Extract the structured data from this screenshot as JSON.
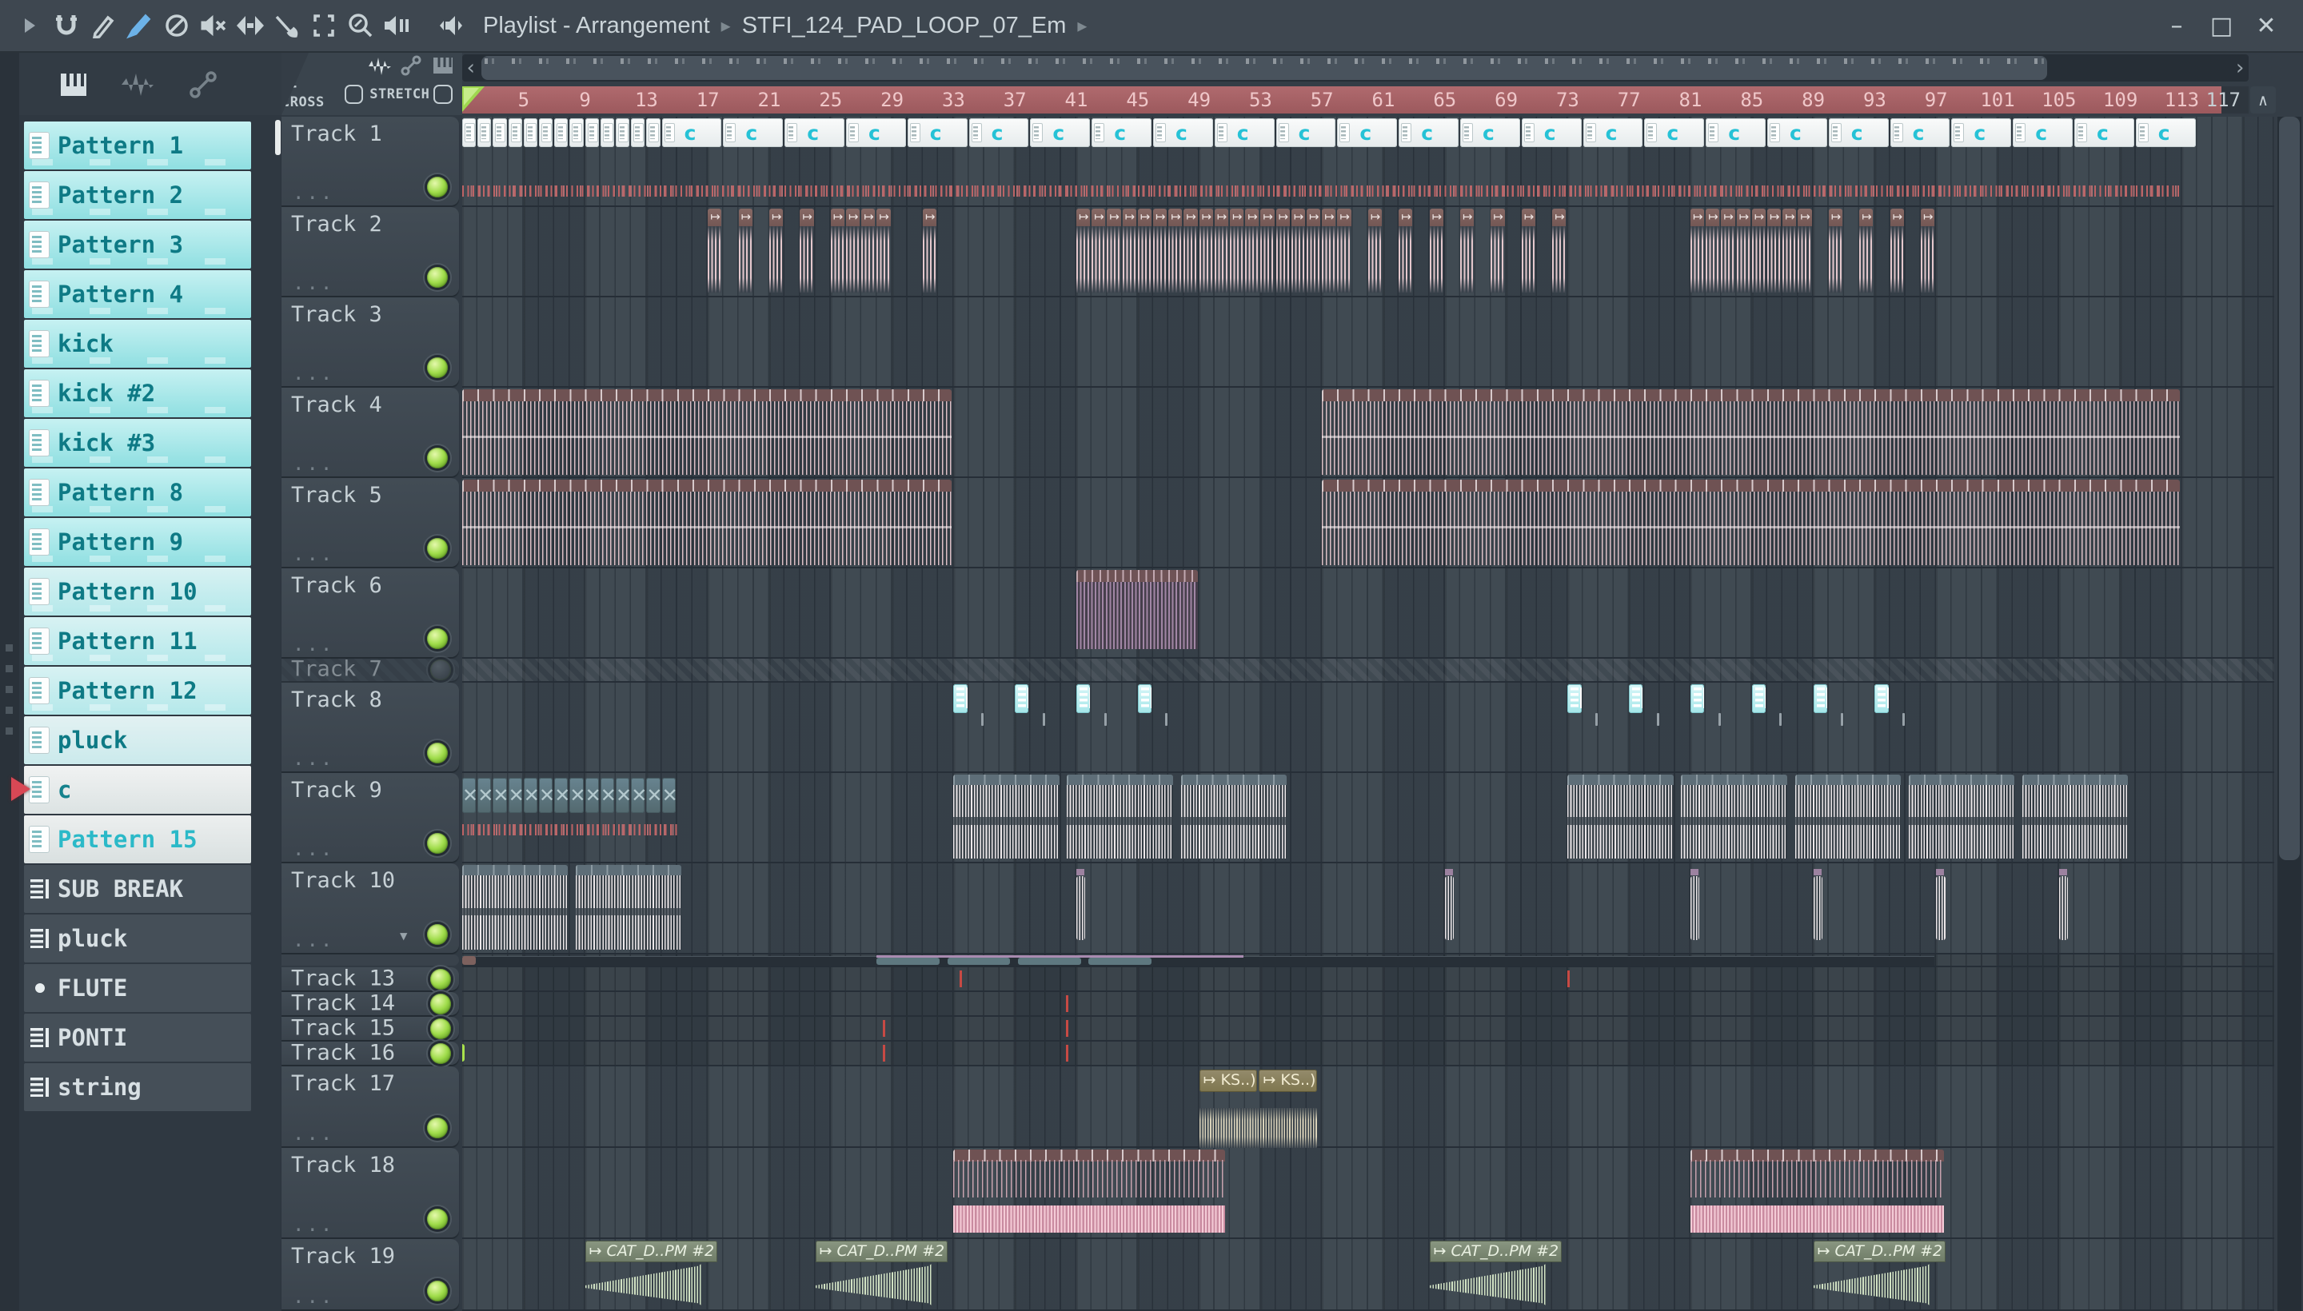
{
  "titlebar": {
    "section": "Playlist - Arrangement",
    "file": "STFI_124_PAD_LOOP_07_Em",
    "crumb_sep": "▸",
    "window": {
      "minimize": "–",
      "maximize": "□",
      "close": "✕"
    }
  },
  "toolbar": {
    "zcross": "Z-CROSS",
    "stretch": "STRETCH"
  },
  "glyphs": {
    "audio": "↦",
    "x": "✕",
    "up": "∧",
    "left": "‹",
    "right": "›",
    "dots": "...",
    "collapse": "▾",
    "bullet": "•"
  },
  "ruler": {
    "numbers": [
      5,
      9,
      13,
      17,
      21,
      25,
      29,
      33,
      37,
      41,
      45,
      49,
      53,
      57,
      61,
      65,
      69,
      73,
      77,
      81,
      85,
      89,
      93,
      97,
      101,
      105,
      109,
      113
    ],
    "end": "117"
  },
  "patterns": [
    {
      "label": "Pattern 1",
      "style": "cyan"
    },
    {
      "label": "Pattern 2",
      "style": "cyan"
    },
    {
      "label": "Pattern 3",
      "style": "cyan"
    },
    {
      "label": "Pattern 4",
      "style": "cyan"
    },
    {
      "label": "kick",
      "style": "cyan"
    },
    {
      "label": "kick #2",
      "style": "cyan"
    },
    {
      "label": "kick #3",
      "style": "cyan"
    },
    {
      "label": "Pattern 8",
      "style": "cyan"
    },
    {
      "label": "Pattern 9",
      "style": "cyan"
    },
    {
      "label": "Pattern 10",
      "style": "cyan2"
    },
    {
      "label": "Pattern 11",
      "style": "cyan2"
    },
    {
      "label": "Pattern 12",
      "style": "cyan2"
    },
    {
      "label": "pluck",
      "style": "cyan3"
    },
    {
      "label": "c",
      "style": "white",
      "selected": true
    },
    {
      "label": "Pattern 15",
      "style": "white2"
    },
    {
      "label": "SUB BREAK",
      "style": "dark"
    },
    {
      "label": "pluck",
      "style": "dark"
    },
    {
      "label": "FLUTE",
      "style": "darkdot"
    },
    {
      "label": "PONTI",
      "style": "dark"
    },
    {
      "label": "string",
      "style": "dark"
    }
  ],
  "tracks": [
    {
      "name": "Track 1",
      "h": 113,
      "kind": "tall"
    },
    {
      "name": "Track 2",
      "h": 113,
      "kind": "tall"
    },
    {
      "name": "Track 3",
      "h": 113,
      "kind": "tall"
    },
    {
      "name": "Track 4",
      "h": 113,
      "kind": "tall"
    },
    {
      "name": "Track 5",
      "h": 113,
      "kind": "tall"
    },
    {
      "name": "Track 6",
      "h": 113,
      "kind": "tall"
    },
    {
      "name": "Track 7",
      "h": 30,
      "kind": "dim"
    },
    {
      "name": "Track 8",
      "h": 113,
      "kind": "tall"
    },
    {
      "name": "Track 9",
      "h": 113,
      "kind": "tall"
    },
    {
      "name": "Track 10",
      "h": 114,
      "kind": "tall",
      "arrow": true
    },
    {
      "name": "",
      "h": 16,
      "kind": "thin"
    },
    {
      "name": "Track 13",
      "h": 31,
      "kind": "small"
    },
    {
      "name": "Track 14",
      "h": 31,
      "kind": "small"
    },
    {
      "name": "Track 15",
      "h": 31,
      "kind": "small"
    },
    {
      "name": "Track 16",
      "h": 31,
      "kind": "small"
    },
    {
      "name": "Track 17",
      "h": 102,
      "kind": "tall"
    },
    {
      "name": "Track 18",
      "h": 114,
      "kind": "tall"
    },
    {
      "name": "Track 19",
      "h": 90,
      "kind": "tall"
    }
  ],
  "clips": [
    {
      "t": 0,
      "type": "mini",
      "len": 1,
      "bars": [
        1,
        2,
        3,
        4,
        5,
        6,
        7,
        8,
        9,
        10,
        11,
        12,
        13
      ]
    },
    {
      "t": 0,
      "type": "cclip",
      "len": 4,
      "label": "c",
      "bars": [
        14,
        18,
        22,
        26,
        30,
        34,
        38,
        42,
        46,
        50,
        54,
        58,
        62,
        66,
        70,
        74,
        78,
        82,
        86,
        90,
        94,
        98,
        102,
        106,
        110
      ]
    },
    {
      "t": 0,
      "type": "redticks",
      "len": 112,
      "yoff": 86,
      "bars": [
        1
      ]
    },
    {
      "t": 1,
      "type": "audio1",
      "len": 1,
      "bars": [
        17,
        19,
        21,
        23,
        25,
        26,
        27,
        28,
        31,
        41,
        42,
        43,
        44,
        45,
        46,
        47,
        48,
        49,
        50,
        51,
        52,
        53,
        54,
        55,
        56,
        57,
        58,
        60,
        62,
        64,
        66,
        68,
        70,
        72,
        81,
        82,
        83,
        84,
        85,
        86,
        87,
        88,
        90,
        92,
        94,
        96
      ]
    },
    {
      "t": 3,
      "type": "stripes",
      "len": 32,
      "bars": [
        1
      ]
    },
    {
      "t": 3,
      "type": "stripes",
      "len": 56,
      "bars": [
        57
      ]
    },
    {
      "t": 4,
      "type": "stripes",
      "len": 32,
      "bars": [
        1
      ]
    },
    {
      "t": 4,
      "type": "stripes",
      "len": 56,
      "bars": [
        57
      ]
    },
    {
      "t": 5,
      "type": "purple",
      "len": 8,
      "bars": [
        41
      ]
    },
    {
      "t": 7,
      "type": "cyanclip",
      "len": 1,
      "bars": [
        33,
        37,
        41,
        45,
        73,
        77,
        81,
        85,
        89,
        93
      ]
    },
    {
      "t": 7,
      "type": "stub",
      "len": 0.25,
      "bars": [
        34.8,
        38.8,
        42.8,
        46.8,
        74.8,
        78.8,
        82.8,
        86.8,
        90.8,
        94.8
      ]
    },
    {
      "t": 8,
      "type": "xclip",
      "len": 1,
      "bars": [
        1,
        2,
        3,
        4,
        5,
        6,
        7,
        8,
        9,
        10,
        11,
        12,
        13,
        14
      ]
    },
    {
      "t": 8,
      "type": "redticks",
      "len": 14,
      "yoff": 64,
      "bars": [
        1
      ]
    },
    {
      "t": 8,
      "type": "wavec",
      "len": 7,
      "bars": [
        33,
        40.4,
        47.8,
        73,
        80.4,
        87.8,
        95.2,
        102.6
      ]
    },
    {
      "t": 9,
      "type": "wavec",
      "len": 7,
      "bars": [
        1,
        8.4
      ]
    },
    {
      "t": 9,
      "type": "hit",
      "len": 0.7,
      "bars": [
        41,
        65,
        81,
        89,
        97,
        105
      ]
    },
    {
      "t": 10,
      "type": "lane",
      "len": 96,
      "bars": [
        1
      ]
    },
    {
      "t": 10,
      "type": "laneline",
      "len": 24,
      "bars": [
        28
      ]
    },
    {
      "t": 10,
      "type": "slate",
      "len": 4.2,
      "bars": [
        28,
        32.6,
        37.2,
        41.8
      ]
    },
    {
      "t": 10,
      "type": "chip",
      "len": 1,
      "bars": [
        1
      ]
    },
    {
      "t": 11,
      "type": "redtick",
      "len": 0.15,
      "bars": [
        33.4,
        73
      ]
    },
    {
      "t": 12,
      "type": "redtick",
      "len": 0.15,
      "bars": [
        40.3
      ]
    },
    {
      "t": 13,
      "type": "redtick",
      "len": 0.15,
      "bars": [
        28.4,
        40.3
      ]
    },
    {
      "t": 14,
      "type": "greenrect",
      "len": 0.9,
      "bars": [
        0.35
      ]
    },
    {
      "t": 14,
      "type": "redtick",
      "len": 0.15,
      "bars": [
        28.4,
        40.3
      ]
    },
    {
      "t": 15,
      "type": "ksclip",
      "len": 3.9,
      "label": "KS..)",
      "bars": [
        49,
        52.9
      ]
    },
    {
      "t": 15,
      "type": "kswave",
      "len": 7.8,
      "bars": [
        49
      ]
    },
    {
      "t": 16,
      "type": "pinkband",
      "len": 17.8,
      "bars": [
        33
      ]
    },
    {
      "t": 16,
      "type": "pinkband",
      "len": 16.6,
      "bars": [
        81
      ]
    },
    {
      "t": 17,
      "type": "cat",
      "len": 8.7,
      "label": "CAT_D..PM #2",
      "bars": [
        9,
        24,
        64,
        89
      ]
    }
  ]
}
